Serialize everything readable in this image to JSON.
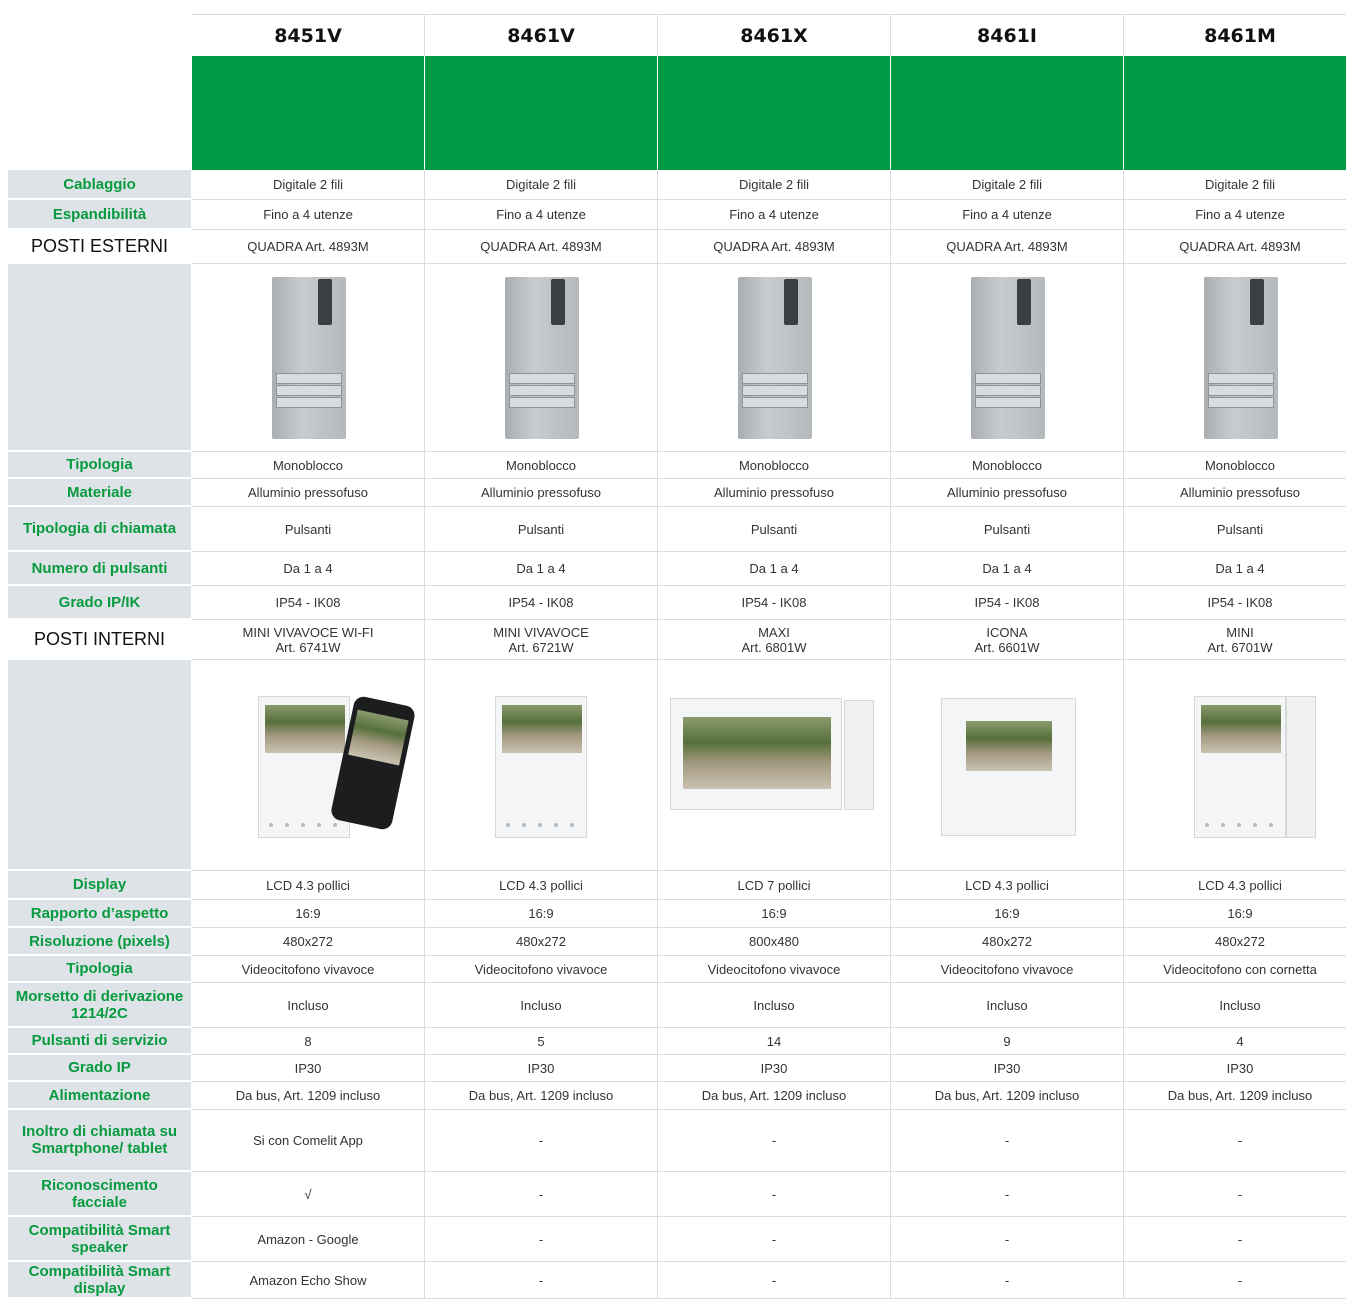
{
  "models": [
    "8451V",
    "8461V",
    "8461X",
    "8461I",
    "8461M"
  ],
  "rows_top": [
    {
      "label": "Cablaggio",
      "values": [
        "Digitale 2 fili",
        "Digitale 2 fili",
        "Digitale 2 fili",
        "Digitale 2 fili",
        "Digitale 2 fili"
      ]
    },
    {
      "label": "Espandibilità",
      "values": [
        "Fino a 4 utenze",
        "Fino a 4 utenze",
        "Fino a 4 utenze",
        "Fino a 4 utenze",
        "Fino a 4 utenze"
      ]
    }
  ],
  "section_external": {
    "label": "POSTI ESTERNI",
    "values": [
      "QUADRA Art. 4893M",
      "QUADRA Art. 4893M",
      "QUADRA Art. 4893M",
      "QUADRA Art. 4893M",
      "QUADRA Art. 4893M"
    ]
  },
  "rows_external": [
    {
      "label": "Tipologia",
      "values": [
        "Monoblocco",
        "Monoblocco",
        "Monoblocco",
        "Monoblocco",
        "Monoblocco"
      ]
    },
    {
      "label": "Materiale",
      "values": [
        "Alluminio pressofuso",
        "Alluminio pressofuso",
        "Alluminio pressofuso",
        "Alluminio pressofuso",
        "Alluminio pressofuso"
      ]
    },
    {
      "label": "Tipologia di chiamata",
      "values": [
        "Pulsanti",
        "Pulsanti",
        "Pulsanti",
        "Pulsanti",
        "Pulsanti"
      ]
    },
    {
      "label": "Numero di pulsanti",
      "values": [
        "Da 1 a 4",
        "Da 1 a 4",
        "Da 1 a 4",
        "Da 1 a 4",
        "Da 1 a 4"
      ]
    },
    {
      "label": "Grado IP/IK",
      "values": [
        "IP54 - IK08",
        "IP54 - IK08",
        "IP54 - IK08",
        "IP54 - IK08",
        "IP54 - IK08"
      ]
    }
  ],
  "section_internal": {
    "label": "POSTI INTERNI",
    "values": [
      {
        "l1": "MINI VIVAVOCE WI-FI",
        "l2": "Art. 6741W"
      },
      {
        "l1": "MINI VIVAVOCE",
        "l2": "Art. 6721W"
      },
      {
        "l1": "MAXI",
        "l2": "Art. 6801W"
      },
      {
        "l1": "ICONA",
        "l2": "Art. 6601W"
      },
      {
        "l1": "MINI",
        "l2": "Art. 6701W"
      }
    ]
  },
  "rows_internal": [
    {
      "label": "Display",
      "values": [
        "LCD 4.3 pollici",
        "LCD 4.3 pollici",
        "LCD 7 pollici",
        "LCD 4.3 pollici",
        "LCD 4.3 pollici"
      ]
    },
    {
      "label": "Rapporto d’aspetto",
      "values": [
        "16:9",
        "16:9",
        "16:9",
        "16:9",
        "16:9"
      ]
    },
    {
      "label": "Risoluzione (pixels)",
      "values": [
        "480x272",
        "480x272",
        "800x480",
        "480x272",
        "480x272"
      ]
    },
    {
      "label": "Tipologia",
      "values": [
        "Videocitofono vivavoce",
        "Videocitofono vivavoce",
        "Videocitofono vivavoce",
        "Videocitofono vivavoce",
        "Videocitofono con cornetta"
      ]
    },
    {
      "label": "Morsetto di derivazione 1214/2C",
      "values": [
        "Incluso",
        "Incluso",
        "Incluso",
        "Incluso",
        "Incluso"
      ]
    },
    {
      "label": "Pulsanti di servizio",
      "values": [
        "8",
        "5",
        "14",
        "9",
        "4"
      ]
    },
    {
      "label": "Grado IP",
      "values": [
        "IP30",
        "IP30",
        "IP30",
        "IP30",
        "IP30"
      ]
    },
    {
      "label": "Alimentazione",
      "values": [
        "Da bus, Art. 1209 incluso",
        "Da bus, Art. 1209 incluso",
        "Da bus, Art. 1209 incluso",
        "Da bus, Art. 1209 incluso",
        "Da bus, Art. 1209 incluso"
      ]
    },
    {
      "label": "Inoltro di chiamata su Smartphone/ tablet",
      "values": [
        "Si con Comelit App",
        "-",
        "-",
        "-",
        "-"
      ]
    },
    {
      "label": "Riconoscimento facciale",
      "values": [
        "√",
        "-",
        "-",
        "-",
        "-"
      ]
    },
    {
      "label": "Compatibilità Smart speaker",
      "values": [
        "Amazon - Google",
        "-",
        "-",
        "-",
        "-"
      ]
    },
    {
      "label": "Compatibilità Smart display",
      "values": [
        "Amazon Echo Show",
        "-",
        "-",
        "-",
        "-"
      ]
    }
  ],
  "colors": {
    "green_band": "#009a44",
    "label_text": "#079a3f",
    "label_bg": "#dde3e7"
  }
}
